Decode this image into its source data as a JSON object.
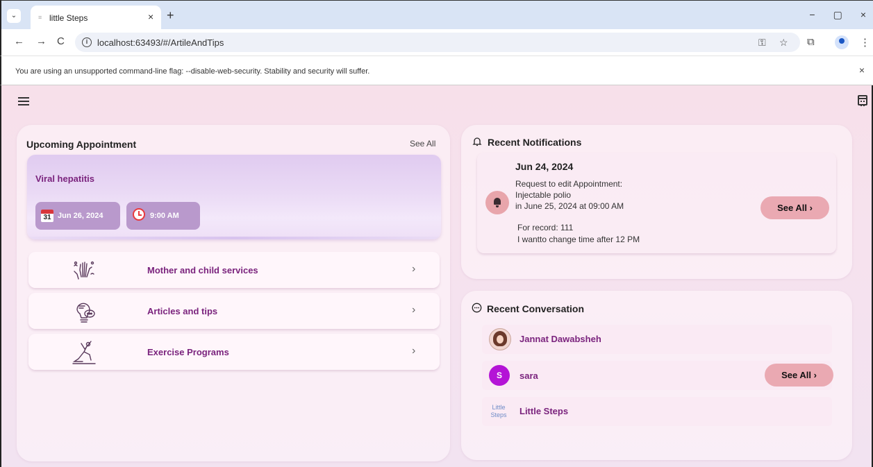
{
  "browser": {
    "tab_title": "little Steps",
    "url": "localhost:63493/#/ArtileAndTips",
    "infobar_text": "You are using an unsupported command-line flag: --disable-web-security. Stability and security will suffer."
  },
  "icons": {
    "back": "←",
    "forward": "→",
    "reload": "C",
    "close": "×",
    "new_tab": "+",
    "minimize": "−",
    "restore": "▢",
    "key": "⚿",
    "star": "☆",
    "extensions": "⧉",
    "more": "⋮",
    "chevron": "›",
    "dropdown": "⌄"
  },
  "appointment": {
    "heading": "Upcoming Appointment",
    "see_all": "See All",
    "name": "Viral hepatitis",
    "date": "Jun 26, 2024",
    "time": "9:00 AM",
    "calendar_day": "31"
  },
  "services": [
    {
      "label": "Mother and child services",
      "icon": "hands-icon"
    },
    {
      "label": "Articles and tips",
      "icon": "lightbulb-chat-icon"
    },
    {
      "label": "Exercise Programs",
      "icon": "yoga-icon"
    }
  ],
  "notifications": {
    "heading": "Recent Notifications",
    "date": "Jun 24, 2024",
    "lines": [
      "Request to edit Appointment:",
      "Injectable polio",
      " in June 25, 2024 at 09:00 AM",
      "For record: 111",
      "I wantto change time after 12 PM"
    ],
    "see_all": "See All"
  },
  "conversations": {
    "heading": "Recent Conversation",
    "items": [
      {
        "name": "Jannat Dawabsheh"
      },
      {
        "name": "sara",
        "initial": "S"
      },
      {
        "name": "Little Steps",
        "logo_line1": "Little",
        "logo_line2": "Steps"
      }
    ],
    "see_all": "See All"
  },
  "colors": {
    "accent_purple": "#7a237d",
    "pill_pink": "#eaa9b2",
    "chip_purple": "#b999cc",
    "avatar_purple": "#b414d6"
  }
}
